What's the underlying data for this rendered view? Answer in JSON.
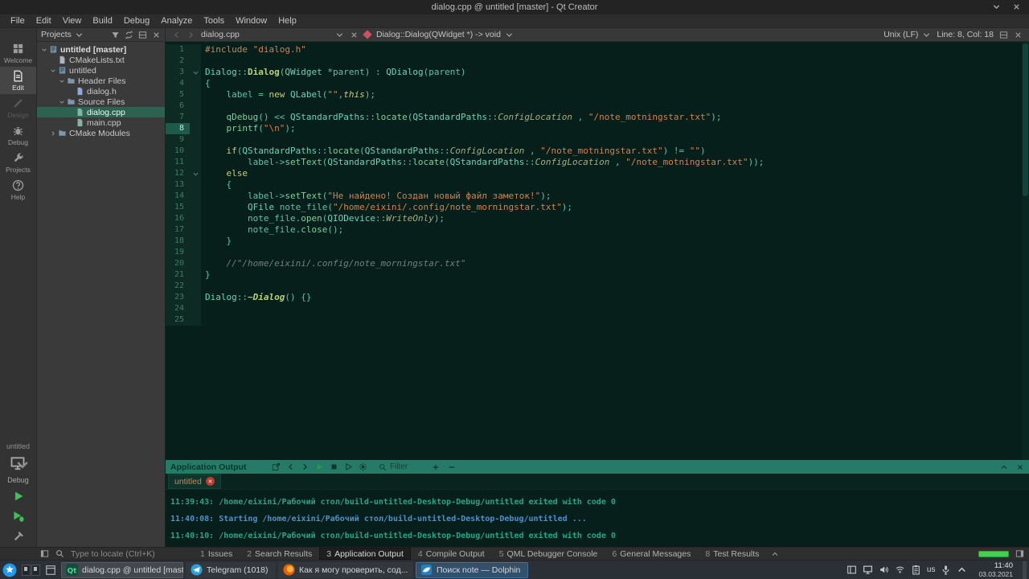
{
  "titlebar": {
    "title": "dialog.cpp @ untitled [master] - Qt Creator"
  },
  "menubar": {
    "items": [
      "File",
      "Edit",
      "View",
      "Build",
      "Debug",
      "Analyze",
      "Tools",
      "Window",
      "Help"
    ]
  },
  "modebar": {
    "modes": [
      {
        "id": "welcome",
        "label": "Welcome",
        "icon": "grid-icon",
        "state": "normal"
      },
      {
        "id": "edit",
        "label": "Edit",
        "icon": "document-icon",
        "state": "active"
      },
      {
        "id": "design",
        "label": "Design",
        "icon": "brush-icon",
        "state": "disabled"
      },
      {
        "id": "debug",
        "label": "Debug",
        "icon": "bug-icon",
        "state": "normal"
      },
      {
        "id": "projects",
        "label": "Projects",
        "icon": "wrench-icon",
        "state": "normal"
      },
      {
        "id": "help",
        "label": "Help",
        "icon": "help-icon",
        "state": "normal"
      }
    ],
    "kit": {
      "project": "untitled",
      "target": "Debug"
    },
    "actions": [
      {
        "name": "run-button",
        "icon": "run-icon",
        "color": "green"
      },
      {
        "name": "debug-run-button",
        "icon": "debug-run-icon",
        "color": "green"
      },
      {
        "name": "build-button",
        "icon": "build-icon",
        "color": "gray"
      }
    ]
  },
  "projects_panel": {
    "title": "Projects",
    "toolbar_icons": [
      "filter-icon",
      "sync-icon",
      "split-icon",
      "close-icon"
    ],
    "tree": [
      {
        "label": "untitled [master]",
        "depth": 0,
        "arrow": "down",
        "icon": "project-icon",
        "bold": true
      },
      {
        "label": "CMakeLists.txt",
        "depth": 1,
        "arrow": "none",
        "icon": "file-icon"
      },
      {
        "label": "untitled",
        "depth": 1,
        "arrow": "down",
        "icon": "project-icon"
      },
      {
        "label": "Header Files",
        "depth": 2,
        "arrow": "down",
        "icon": "folder-icon"
      },
      {
        "label": "dialog.h",
        "depth": 3,
        "arrow": "none",
        "icon": "header-file-icon"
      },
      {
        "label": "Source Files",
        "depth": 2,
        "arrow": "down",
        "icon": "folder-icon"
      },
      {
        "label": "dialog.cpp",
        "depth": 3,
        "arrow": "none",
        "icon": "cpp-file-icon",
        "selected": true
      },
      {
        "label": "main.cpp",
        "depth": 3,
        "arrow": "none",
        "icon": "cpp-file-icon"
      },
      {
        "label": "CMake Modules",
        "depth": 1,
        "arrow": "right",
        "icon": "folder-icon"
      }
    ]
  },
  "editor_toolbar": {
    "open_document": "dialog.cpp",
    "symbol": "Dialog::Dialog(QWidget *) -> void",
    "encoding": "Unix (LF)",
    "cursor_position": "Line: 8, Col: 18"
  },
  "editor": {
    "current_line": 8,
    "fold_lines": [
      3,
      12
    ],
    "lines": [
      [
        [
          "pre",
          "#include "
        ],
        [
          "str",
          "\"dialog.h\""
        ]
      ],
      [],
      [
        [
          "typ",
          "Dialog"
        ],
        [
          "txt",
          "::"
        ],
        [
          "fnd",
          "Dialog"
        ],
        [
          "txt",
          "("
        ],
        [
          "typ",
          "QWidget"
        ],
        [
          "txt",
          " *parent) : "
        ],
        [
          "typ",
          "QDialog"
        ],
        [
          "txt",
          "(parent)"
        ]
      ],
      [
        [
          "txt",
          "{"
        ]
      ],
      [
        [
          "txt",
          "    label = "
        ],
        [
          "kw",
          "new"
        ],
        [
          "txt",
          " "
        ],
        [
          "typ",
          "QLabel"
        ],
        [
          "txt",
          "("
        ],
        [
          "str",
          "\"\""
        ],
        [
          "txt",
          ","
        ],
        [
          "kwi",
          "this"
        ],
        [
          "txt",
          ");"
        ]
      ],
      [],
      [
        [
          "txt",
          "    "
        ],
        [
          "fn",
          "qDebug"
        ],
        [
          "txt",
          "() << "
        ],
        [
          "typ",
          "QStandardPaths"
        ],
        [
          "txt",
          "::"
        ],
        [
          "fn",
          "locate"
        ],
        [
          "txt",
          "("
        ],
        [
          "typ",
          "QStandardPaths"
        ],
        [
          "txt",
          "::"
        ],
        [
          "enm",
          "ConfigLocation"
        ],
        [
          "txt",
          " , "
        ],
        [
          "str",
          "\"/note_motningstar.txt\""
        ],
        [
          "txt",
          ");"
        ]
      ],
      [
        [
          "txt",
          "    "
        ],
        [
          "fn",
          "printf"
        ],
        [
          "txt",
          "("
        ],
        [
          "str",
          "\"\\n\""
        ],
        [
          "txt",
          ");"
        ]
      ],
      [],
      [
        [
          "txt",
          "    "
        ],
        [
          "kw",
          "if"
        ],
        [
          "txt",
          "("
        ],
        [
          "typ",
          "QStandardPaths"
        ],
        [
          "txt",
          "::"
        ],
        [
          "fn",
          "locate"
        ],
        [
          "txt",
          "("
        ],
        [
          "typ",
          "QStandardPaths"
        ],
        [
          "txt",
          "::"
        ],
        [
          "enm",
          "ConfigLocation"
        ],
        [
          "txt",
          " , "
        ],
        [
          "str",
          "\"/note_motningstar.txt\""
        ],
        [
          "txt",
          ") != "
        ],
        [
          "str",
          "\"\""
        ],
        [
          "txt",
          ")"
        ]
      ],
      [
        [
          "txt",
          "        label->"
        ],
        [
          "fn",
          "setText"
        ],
        [
          "txt",
          "("
        ],
        [
          "typ",
          "QStandardPaths"
        ],
        [
          "txt",
          "::"
        ],
        [
          "fn",
          "locate"
        ],
        [
          "txt",
          "("
        ],
        [
          "typ",
          "QStandardPaths"
        ],
        [
          "txt",
          "::"
        ],
        [
          "enm",
          "ConfigLocation"
        ],
        [
          "txt",
          " , "
        ],
        [
          "str",
          "\"/note_motningstar.txt\""
        ],
        [
          "txt",
          "));"
        ]
      ],
      [
        [
          "txt",
          "    "
        ],
        [
          "kw",
          "else"
        ]
      ],
      [
        [
          "txt",
          "    {"
        ]
      ],
      [
        [
          "txt",
          "        label->"
        ],
        [
          "fn",
          "setText"
        ],
        [
          "txt",
          "("
        ],
        [
          "str",
          "\"Не найдено! Создан новый файл заметок!\""
        ],
        [
          "txt",
          ");"
        ]
      ],
      [
        [
          "txt",
          "        "
        ],
        [
          "typ",
          "QFile"
        ],
        [
          "txt",
          " note_file("
        ],
        [
          "str",
          "\"/home/eixini/.config/note_morningstar.txt\""
        ],
        [
          "txt",
          ");"
        ]
      ],
      [
        [
          "txt",
          "        note_file."
        ],
        [
          "fn",
          "open"
        ],
        [
          "txt",
          "("
        ],
        [
          "typ",
          "QIODevice"
        ],
        [
          "txt",
          "::"
        ],
        [
          "enm",
          "WriteOnly"
        ],
        [
          "txt",
          ");"
        ]
      ],
      [
        [
          "txt",
          "        note_file."
        ],
        [
          "fn",
          "close"
        ],
        [
          "txt",
          "();"
        ]
      ],
      [
        [
          "txt",
          "    }"
        ]
      ],
      [],
      [
        [
          "com",
          "    //\"/home/eixini/.config/note_morningstar.txt\""
        ]
      ],
      [
        [
          "txt",
          "}"
        ]
      ],
      [],
      [
        [
          "typ",
          "Dialog"
        ],
        [
          "txt",
          "::"
        ],
        [
          "dtor",
          "~Dialog"
        ],
        [
          "txt",
          "() {}"
        ]
      ],
      [],
      []
    ]
  },
  "output_pane": {
    "title": "Application Output",
    "toolbar_icons": [
      "open-output-icon",
      "chevron-left-icon",
      "chevron-right-icon",
      "run-icon",
      "stop-icon",
      "rerun-icon",
      "gear-icon"
    ],
    "zoom_icons": [
      "zoom-in-icon",
      "zoom-out-icon"
    ],
    "corner_icons": [
      "collapse-icon",
      "close-icon"
    ],
    "filter_placeholder": "Filter",
    "tab_label": "untitled",
    "lines": [
      {
        "kind": "exit",
        "text": "11:39:43: /home/eixini/Рабочий стол/build-untitled-Desktop-Debug/untitled exited with code 0"
      },
      {
        "kind": "start",
        "text": "11:40:08: Starting /home/eixini/Рабочий стол/build-untitled-Desktop-Debug/untitled ..."
      },
      {
        "kind": "exit",
        "text": "11:40:10: /home/eixini/Рабочий стол/build-untitled-Desktop-Debug/untitled exited with code 0"
      }
    ]
  },
  "locator": {
    "placeholder": "Type to locate (Ctrl+K)",
    "panes": [
      {
        "num": "1",
        "label": "Issues",
        "active": false
      },
      {
        "num": "2",
        "label": "Search Results",
        "active": false
      },
      {
        "num": "3",
        "label": "Application Output",
        "active": true
      },
      {
        "num": "4",
        "label": "Compile Output",
        "active": false
      },
      {
        "num": "5",
        "label": "QML Debugger Console",
        "active": false
      },
      {
        "num": "6",
        "label": "General Messages",
        "active": false
      },
      {
        "num": "8",
        "label": "Test Results",
        "active": false
      }
    ]
  },
  "taskbar": {
    "tasks": [
      {
        "label": "dialog.cpp @ untitled [maste...",
        "icon": "qtcreator-icon",
        "state": "active"
      },
      {
        "label": "Telegram (1018)",
        "icon": "telegram-icon",
        "state": "normal"
      },
      {
        "label": "Как я могу проверить, сод...",
        "icon": "firefox-icon",
        "state": "normal"
      },
      {
        "label": "Поиск note — Dolphin",
        "icon": "dolphin-icon",
        "state": "attention"
      }
    ],
    "tray_icons": [
      "panel-icon",
      "display-icon",
      "volume-icon",
      "network-icon",
      "clipboard-icon"
    ],
    "tray_icons_after": [
      "mic-icon",
      "chevron-up-icon"
    ],
    "keyboard_layout": "us",
    "clock": {
      "time": "11:40",
      "date": "03.03.2021"
    }
  },
  "colors": {
    "editor_background": "#071f1a",
    "accent_teal": "#267a68",
    "selection_teal": "#2d6152",
    "string_orange": "#cf8350",
    "keyword_yellow": "#c9cd7c",
    "run_green": "#3fbf57",
    "progress_green": "#3fd14f",
    "attention_blue": "#31506b",
    "close_red": "#c0392b"
  }
}
